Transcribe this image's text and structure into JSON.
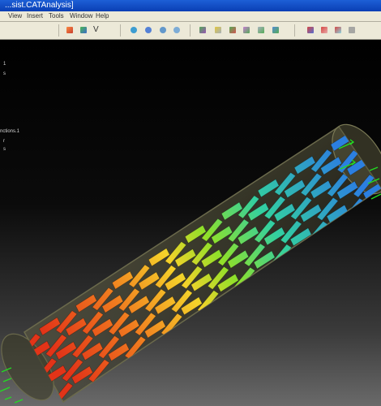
{
  "window": {
    "title": "...sist.CATAnalysis]"
  },
  "menu": {
    "items": [
      "View",
      "Insert",
      "Tools",
      "Window",
      "Help"
    ]
  },
  "toolbar": {
    "letter_v": "V"
  },
  "tree": {
    "lines": [
      "1",
      "s",
      "nctions.1",
      "r",
      "s"
    ]
  },
  "colors": {
    "titlebar": "#0a3fb4",
    "toolbar_bg": "#ece9d8",
    "viewport_bg": "#000000",
    "hot": "#e8431c",
    "mid": "#9be12a",
    "cold": "#2f8be0",
    "vector": "#22dd22"
  }
}
